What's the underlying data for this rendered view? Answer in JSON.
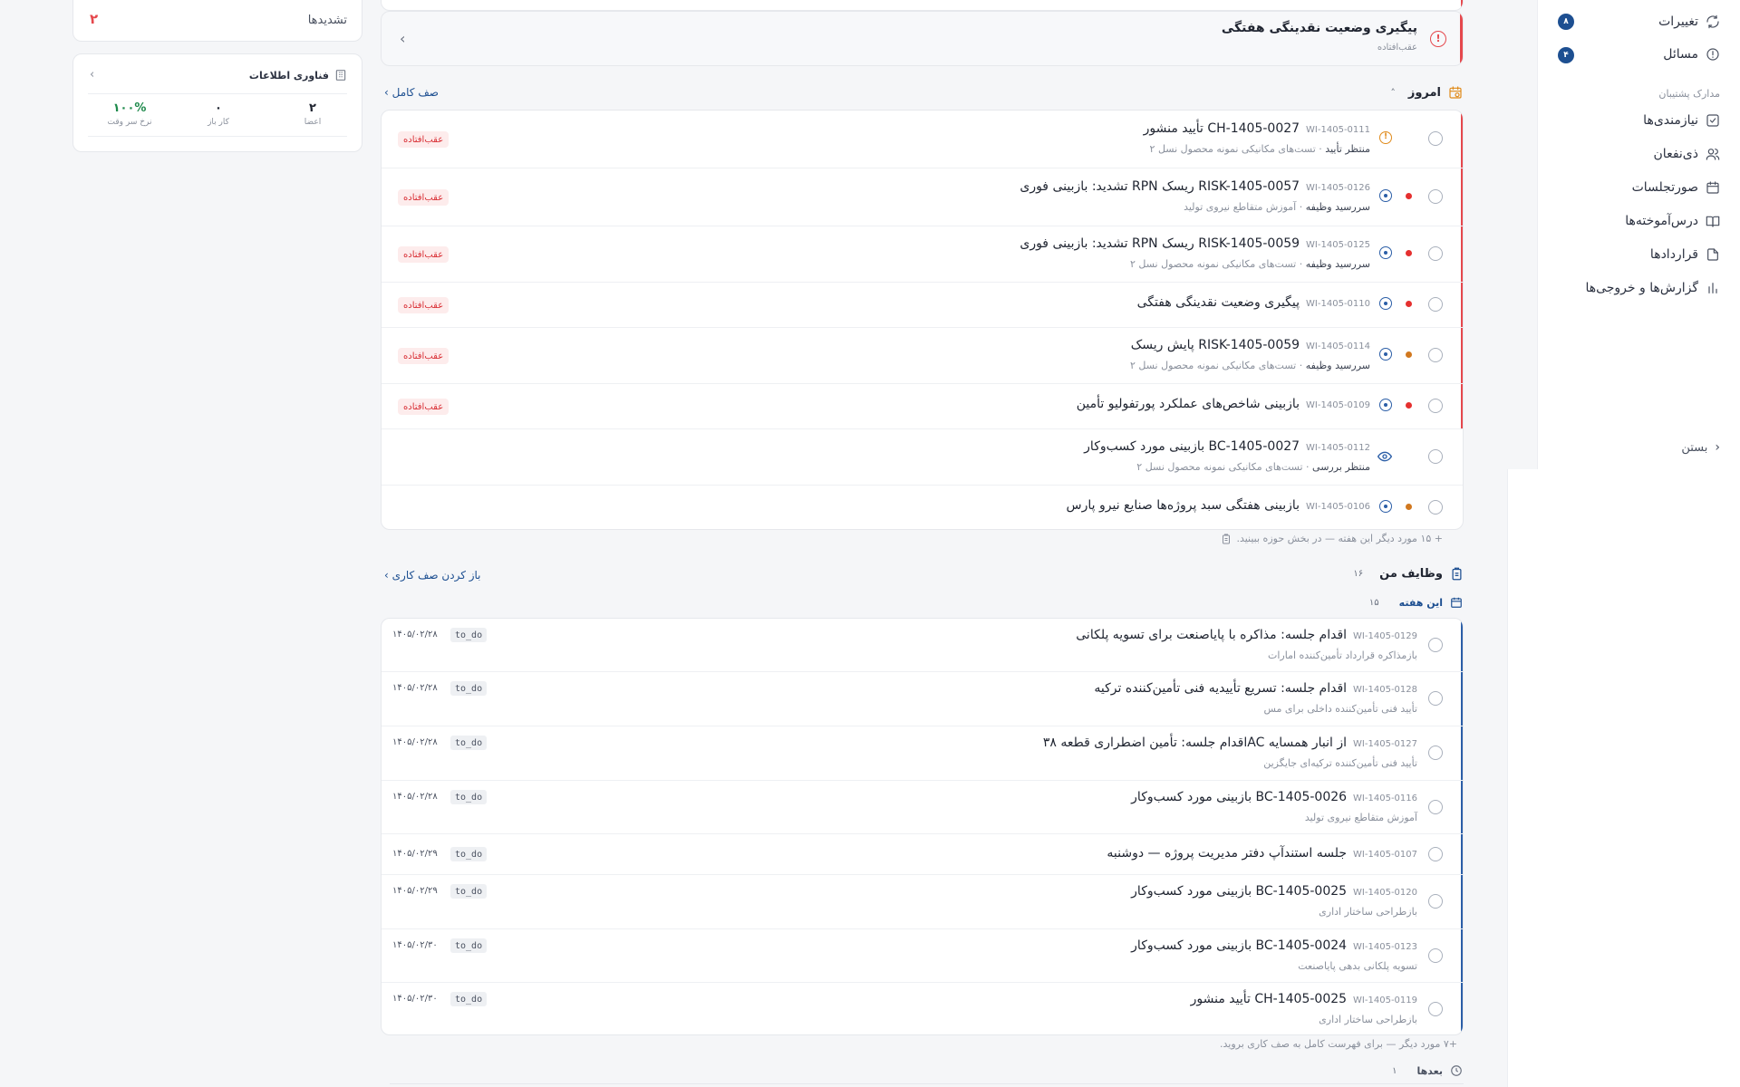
{
  "sidebar": {
    "items_top": [
      {
        "label": "تغییرات",
        "icon": "refresh-icon",
        "badge": "۸"
      },
      {
        "label": "مسائل",
        "icon": "alert-circle-icon",
        "badge": "۴"
      }
    ],
    "section_label": "مدارک پشتیبان",
    "items": [
      {
        "label": "نیازمندی‌ها",
        "icon": "checkbox-icon"
      },
      {
        "label": "ذی‌نفعان",
        "icon": "users-icon"
      },
      {
        "label": "صورتجلسات",
        "icon": "calendar-icon"
      },
      {
        "label": "درس‌آموخته‌ها",
        "icon": "book-open-icon"
      },
      {
        "label": "قراردادها",
        "icon": "file-icon"
      },
      {
        "label": "گزارش‌ها و خروجی‌ها",
        "icon": "bar-chart-icon"
      }
    ],
    "close_label": "بستن"
  },
  "left": {
    "escalations_label": "تشدیدها",
    "escalations_count": "۲",
    "team": {
      "title": "فناوری اطلاعات",
      "stats": [
        {
          "value": "۲",
          "label": "اعضا"
        },
        {
          "value": "۰",
          "label": "کار باز"
        },
        {
          "value": "۱۰۰%",
          "label": "نرخ سر وقت"
        }
      ]
    }
  },
  "alert": {
    "title": "پیگیری وضعیت نقدینگی هفتگی",
    "subtitle": "عقب‌افتاده"
  },
  "today": {
    "title": "امروز",
    "collapse_glyph": "˄",
    "link": "صف کامل",
    "rows": [
      {
        "id": "WI-1405-0111",
        "title": "تأیید منشور CH-1405-0027",
        "status": "منتظر تأیید",
        "context": "تست‌های مکانیکی نمونه محصول نسل ۲",
        "tag": "عقب‌افتاده"
      },
      {
        "id": "WI-1405-0126",
        "title": "تشدید: بازبینی فوری RPN ریسک RISK-1405-0057",
        "status": "سررسید وظیفه",
        "context": "آموزش متقاطع نیروی تولید",
        "tag": "عقب‌افتاده"
      },
      {
        "id": "WI-1405-0125",
        "title": "تشدید: بازبینی فوری RPN ریسک RISK-1405-0059",
        "status": "سررسید وظیفه",
        "context": "تست‌های مکانیکی نمونه محصول نسل ۲",
        "tag": "عقب‌افتاده"
      },
      {
        "id": "WI-1405-0110",
        "title": "پیگیری وضعیت نقدینگی هفتگی",
        "status": "",
        "context": "",
        "tag": "عقب‌افتاده"
      },
      {
        "id": "WI-1405-0114",
        "title": "پایش ریسک RISK-1405-0059",
        "status": "سررسید وظیفه",
        "context": "تست‌های مکانیکی نمونه محصول نسل ۲",
        "tag": "عقب‌افتاده"
      },
      {
        "id": "WI-1405-0109",
        "title": "بازبینی شاخص‌های عملکرد پورتفولیو تأمین",
        "status": "",
        "context": "",
        "tag": "عقب‌افتاده"
      },
      {
        "id": "WI-1405-0112",
        "title": "بازبینی مورد کسب‌وکار BC-1405-0027",
        "status": "منتظر بررسی",
        "context": "تست‌های مکانیکی نمونه محصول نسل ۲",
        "tag": ""
      },
      {
        "id": "WI-1405-0106",
        "title": "بازبینی هفتگی سبد پروژه‌ها صنایع نیرو پارس",
        "status": "",
        "context": "",
        "tag": ""
      }
    ],
    "more_note": "+ ۱۵ مورد دیگر این هفته — در بخش حوزه ببینید."
  },
  "my_tasks": {
    "title": "وظایف من",
    "count": "۱۶",
    "link": "باز کردن صف کاری",
    "week_title": "این هفته",
    "week_count": "۱۵",
    "rows": [
      {
        "id": "WI-1405-0129",
        "title": "اقدام جلسه: مذاکره با پایاصنعت برای تسویه پلکانی",
        "context": "بازمذاکره قرارداد تأمین‌کننده امارات",
        "state": "to_do",
        "date": "۱۴۰۵/۰۲/۲۸"
      },
      {
        "id": "WI-1405-0128",
        "title": "اقدام جلسه: تسریع تأییدیه فنی تأمین‌کننده ترکیه",
        "context": "تأیید فنی تأمین‌کننده داخلی برای مس",
        "state": "to_do",
        "date": "۱۴۰۵/۰۲/۲۸"
      },
      {
        "id": "WI-1405-0127",
        "title": "اقدام جلسه: تأمین اضطراری قطعه ۳۸AC از انبار همسایه",
        "context": "تأیید فنی تأمین‌کننده ترکیه‌ای جایگزین",
        "state": "to_do",
        "date": "۱۴۰۵/۰۲/۲۸"
      },
      {
        "id": "WI-1405-0116",
        "title": "بازبینی مورد کسب‌وکار BC-1405-0026",
        "context": "آموزش متقاطع نیروی تولید",
        "state": "to_do",
        "date": "۱۴۰۵/۰۲/۲۸"
      },
      {
        "id": "WI-1405-0107",
        "title": "جلسه استندآپ دفتر مدیریت پروژه — دوشنبه",
        "context": "",
        "state": "to_do",
        "date": "۱۴۰۵/۰۲/۲۹"
      },
      {
        "id": "WI-1405-0120",
        "title": "بازبینی مورد کسب‌وکار BC-1405-0025",
        "context": "بازطراحی ساختار اداری",
        "state": "to_do",
        "date": "۱۴۰۵/۰۲/۲۹"
      },
      {
        "id": "WI-1405-0123",
        "title": "بازبینی مورد کسب‌وکار BC-1405-0024",
        "context": "تسویه پلکانی بدهی پایاصنعت",
        "state": "to_do",
        "date": "۱۴۰۵/۰۲/۳۰"
      },
      {
        "id": "WI-1405-0119",
        "title": "تأیید منشور CH-1405-0025",
        "context": "بازطراحی ساختار اداری",
        "state": "to_do",
        "date": "۱۴۰۵/۰۲/۳۰"
      }
    ],
    "more_note": "+۷ مورد دیگر — برای فهرست کامل به صف کاری بروید.",
    "later_title": "بعدها",
    "later_count": "۱"
  },
  "colors": {
    "accent": "#1d4f91",
    "overdue": "#e5484d",
    "warning": "#e08a1a",
    "positive": "#1f8a4c"
  }
}
